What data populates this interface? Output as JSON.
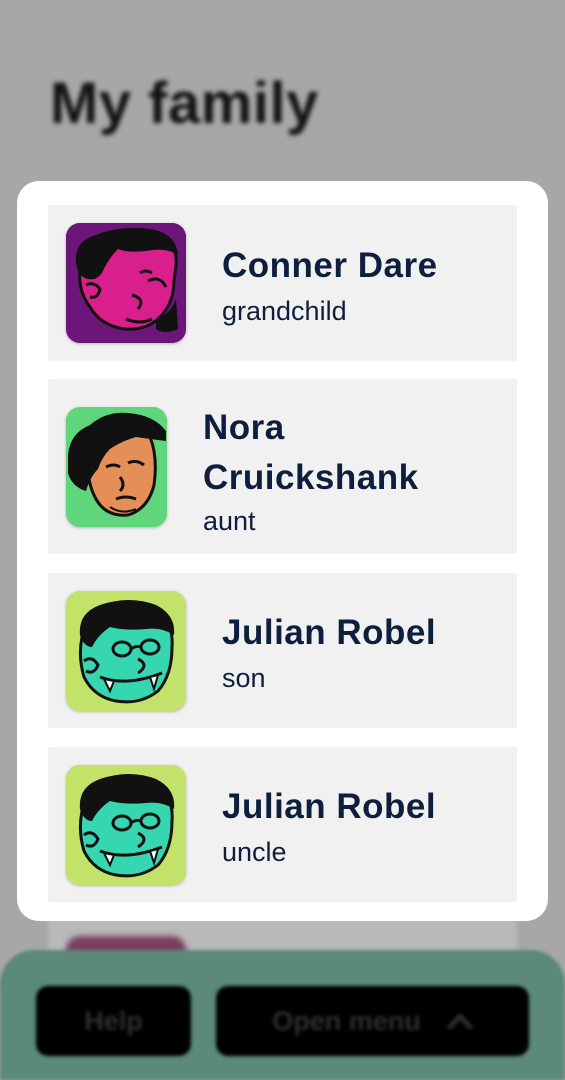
{
  "page": {
    "title": "My family"
  },
  "family": {
    "members": [
      {
        "name": "Conner Dare",
        "relation": "grandchild",
        "avatar_icon": "avatar-face-pink-icon",
        "avatar_bg": "#6b1678"
      },
      {
        "name": "Nora Cruickshank",
        "relation": "aunt",
        "avatar_icon": "avatar-face-orange-icon",
        "avatar_bg": "#5fd67b"
      },
      {
        "name": "Julian Robel",
        "relation": "son",
        "avatar_icon": "avatar-face-green-vampire-icon",
        "avatar_bg": "#c2e26a"
      },
      {
        "name": "Julian Robel",
        "relation": "uncle",
        "avatar_icon": "avatar-face-green-vampire-icon",
        "avatar_bg": "#c2e26a"
      }
    ]
  },
  "bottom_bar": {
    "help_label": "Help",
    "menu_label": "Open menu",
    "menu_icon": "chevron-up-icon"
  },
  "colors": {
    "accent_bar": "#5b897a",
    "text_primary": "#0e1f3d",
    "card_bg": "#f1f1f1"
  }
}
